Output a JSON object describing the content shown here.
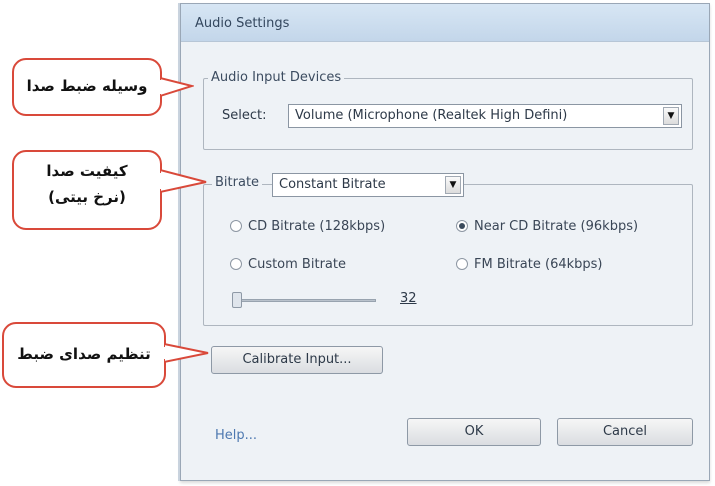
{
  "dialog": {
    "title": "Audio Settings",
    "input_devices": {
      "legend": "Audio Input Devices",
      "select_label": "Select:",
      "select_value": "Volume (Microphone (Realtek High Defini)"
    },
    "bitrate": {
      "label": "Bitrate",
      "value": "Constant Bitrate",
      "options": [
        {
          "label": "CD Bitrate (128kbps)",
          "selected": false
        },
        {
          "label": "Near CD Bitrate (96kbps)",
          "selected": true
        },
        {
          "label": "Custom Bitrate",
          "selected": false
        },
        {
          "label": "FM Bitrate (64kbps)",
          "selected": false
        }
      ],
      "slider_value": "32"
    },
    "calibrate_label": "Calibrate Input...",
    "help_label": "Help...",
    "ok_label": "OK",
    "cancel_label": "Cancel"
  },
  "annotations": {
    "device": "وسیله ضبط صدا",
    "quality_line1": "کیفیت صدا",
    "quality_line2": "(نرخ بیتی)",
    "calibrate": "تنظیم صدای ضبط"
  },
  "colors": {
    "callout_border": "#d9493a",
    "dialog_bg": "#eef2f6"
  }
}
